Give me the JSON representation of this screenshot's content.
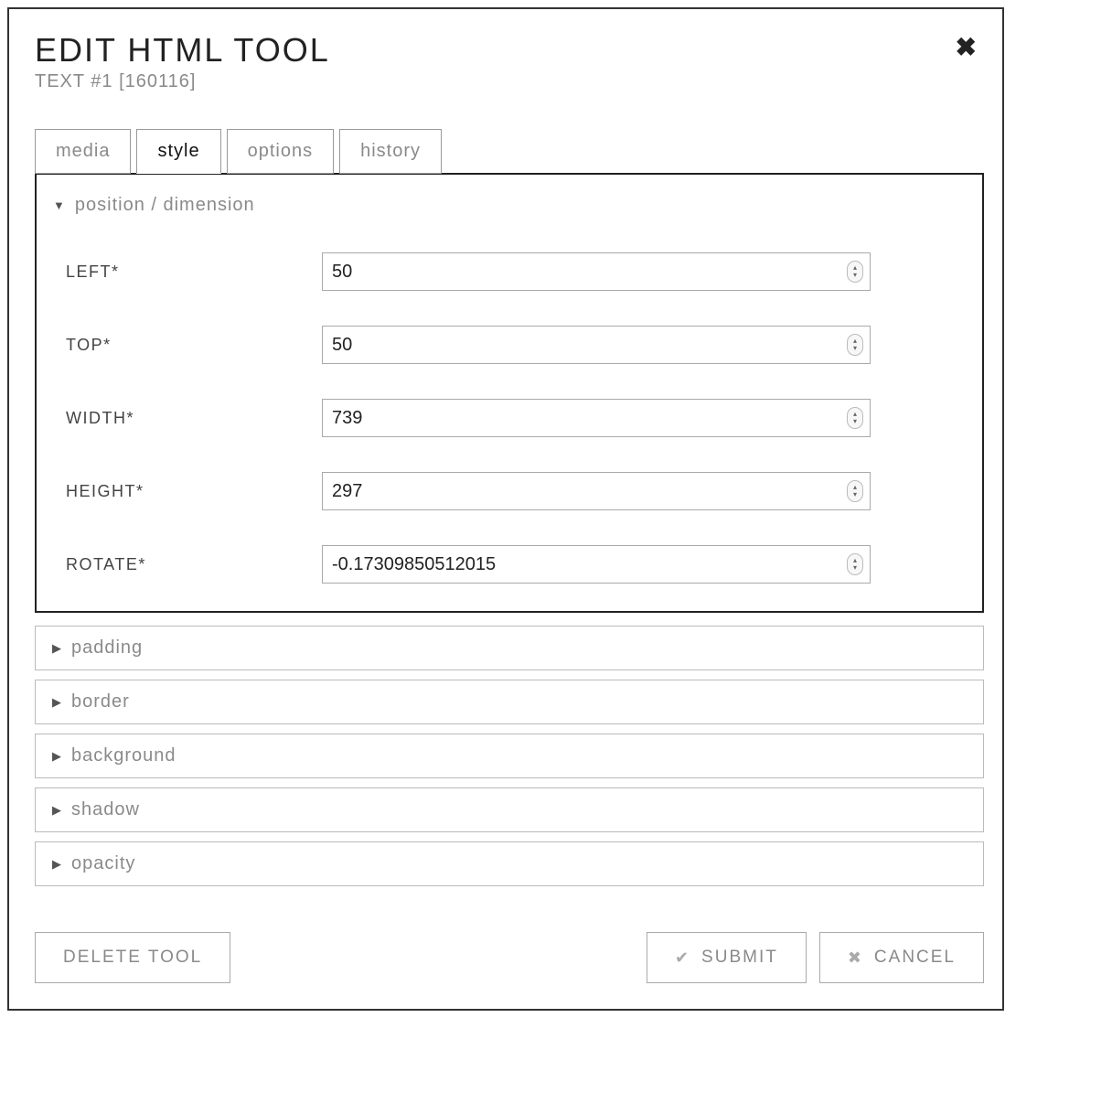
{
  "header": {
    "title": "EDIT HTML TOOL",
    "subtitle": "TEXT #1 [160116]"
  },
  "tabs": [
    {
      "label": "media",
      "active": false
    },
    {
      "label": "style",
      "active": true
    },
    {
      "label": "options",
      "active": false
    },
    {
      "label": "history",
      "active": false
    }
  ],
  "section_expanded": {
    "title": "position / dimension",
    "fields": [
      {
        "label": "LEFT*",
        "value": "50"
      },
      {
        "label": "TOP*",
        "value": "50"
      },
      {
        "label": "WIDTH*",
        "value": "739"
      },
      {
        "label": "HEIGHT*",
        "value": "297"
      },
      {
        "label": "ROTATE*",
        "value": "-0.17309850512015"
      }
    ]
  },
  "sections_collapsed": [
    {
      "title": "padding"
    },
    {
      "title": "border"
    },
    {
      "title": "background"
    },
    {
      "title": "shadow"
    },
    {
      "title": "opacity"
    }
  ],
  "footer": {
    "delete": "DELETE TOOL",
    "submit": "SUBMIT",
    "cancel": "CANCEL"
  }
}
